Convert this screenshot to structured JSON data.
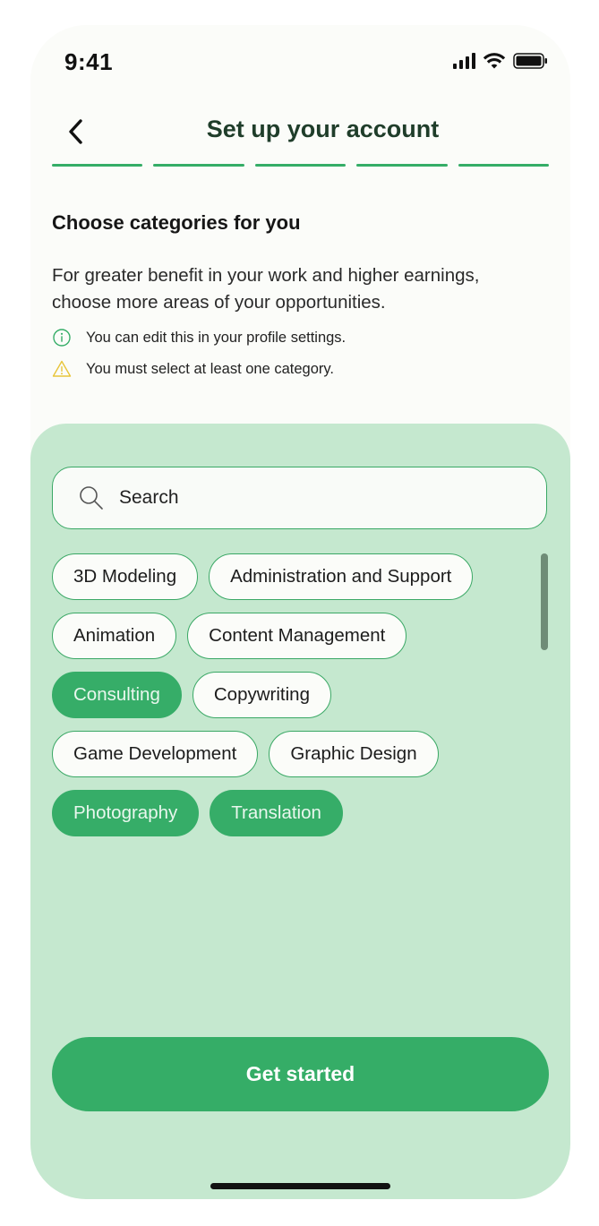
{
  "status_bar": {
    "time": "9:41",
    "icons": [
      "signal-icon",
      "wifi-icon",
      "battery-icon"
    ]
  },
  "header": {
    "title": "Set up your account",
    "back_icon": "chevron-left-icon"
  },
  "progress": {
    "steps_total": 5,
    "steps_completed": 5,
    "color": "#35ad67"
  },
  "content": {
    "section_title": "Choose categories for you",
    "description": "For greater benefit in your work and higher earnings, choose more areas of your opportunities.",
    "notes": [
      {
        "icon": "info-icon",
        "text": "You can edit this in your profile settings.",
        "color": "#35ad67"
      },
      {
        "icon": "warning-icon",
        "text": "You must select at least one category.",
        "color": "#e8c53a"
      }
    ]
  },
  "search": {
    "placeholder": "Search",
    "value": ""
  },
  "categories": [
    {
      "label": "3D Modeling",
      "selected": false
    },
    {
      "label": "Administration and Support",
      "selected": false
    },
    {
      "label": "Animation",
      "selected": false
    },
    {
      "label": "Content Management",
      "selected": false
    },
    {
      "label": "Consulting",
      "selected": true
    },
    {
      "label": "Copywriting",
      "selected": false
    },
    {
      "label": "Game Development",
      "selected": false
    },
    {
      "label": "Graphic Design",
      "selected": false
    },
    {
      "label": "Photography",
      "selected": true
    },
    {
      "label": "Translation",
      "selected": true
    }
  ],
  "cta": {
    "label": "Get started"
  },
  "colors": {
    "accent": "#35ad67",
    "panel": "#c5e8cf",
    "background": "#fbfcf9",
    "title": "#1f3d2a"
  }
}
